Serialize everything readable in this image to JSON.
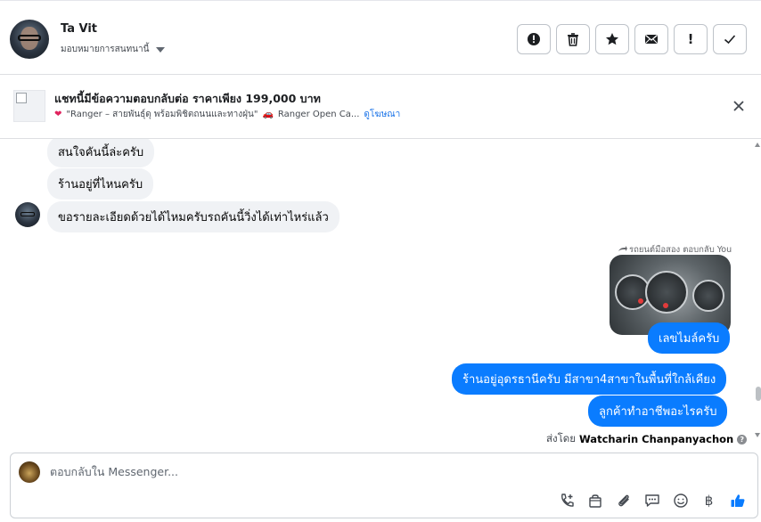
{
  "header": {
    "user_name": "Ta Vit",
    "assign_label": "มอบหมายการสนทนานี้",
    "actions": [
      {
        "name": "spam-button",
        "icon": "alert-circle-icon"
      },
      {
        "name": "delete-button",
        "icon": "trash-icon"
      },
      {
        "name": "star-button",
        "icon": "star-icon"
      },
      {
        "name": "mark-unread-button",
        "icon": "envelope-icon"
      },
      {
        "name": "follow-up-button",
        "icon": "exclamation-icon",
        "text": "!"
      },
      {
        "name": "mark-done-button",
        "icon": "check-icon"
      }
    ]
  },
  "banner": {
    "title": "แชทนี้มีข้อความตอบกลับต่อ ราคาเพียง 199,000 บาท",
    "subtitle": "\"Ranger – สายพันธุ์ดุ พร้อมพิชิตถนนและทางฝุ่น\"",
    "subtitle_more": "Ranger Open Ca...",
    "link": "ดูโฆษณา"
  },
  "messages": {
    "in_1": "สนใจคันนี้ล่ะครับ",
    "in_2": "ร้านอยู่ที่ไหนครับ",
    "in_3": "ขอรายละเอียดด้วยได้ไหมครับรถคันนี้วิ่งได้เท่าไหร่แล้ว",
    "reply_meta": "รถยนต์มือสอง ตอบกลับ You",
    "out_1": "เลขไมล์ครับ",
    "out_2": "ร้านอยู่อุดรธานีครับ มีสาขา4สาขาในพื้นที่ใกล้เคียง",
    "out_3": "ลูกค้าทำอาชีพอะไรครับ",
    "sent_by_label": "ส่งโดย",
    "sent_by_name": "Watcharin Chanpanyachon"
  },
  "composer": {
    "placeholder": "ตอบกลับใน Messenger...",
    "tools": [
      "phone-plus-icon",
      "shopping-bag-icon",
      "paperclip-icon",
      "chat-dots-icon",
      "smiley-icon",
      "baht-icon",
      "thumbs-up-icon"
    ],
    "baht_symbol": "฿"
  },
  "colors": {
    "outgoing_bubble": "#0a7cff",
    "incoming_bubble": "#f0f2f5",
    "like_icon": "#0a7cff"
  }
}
